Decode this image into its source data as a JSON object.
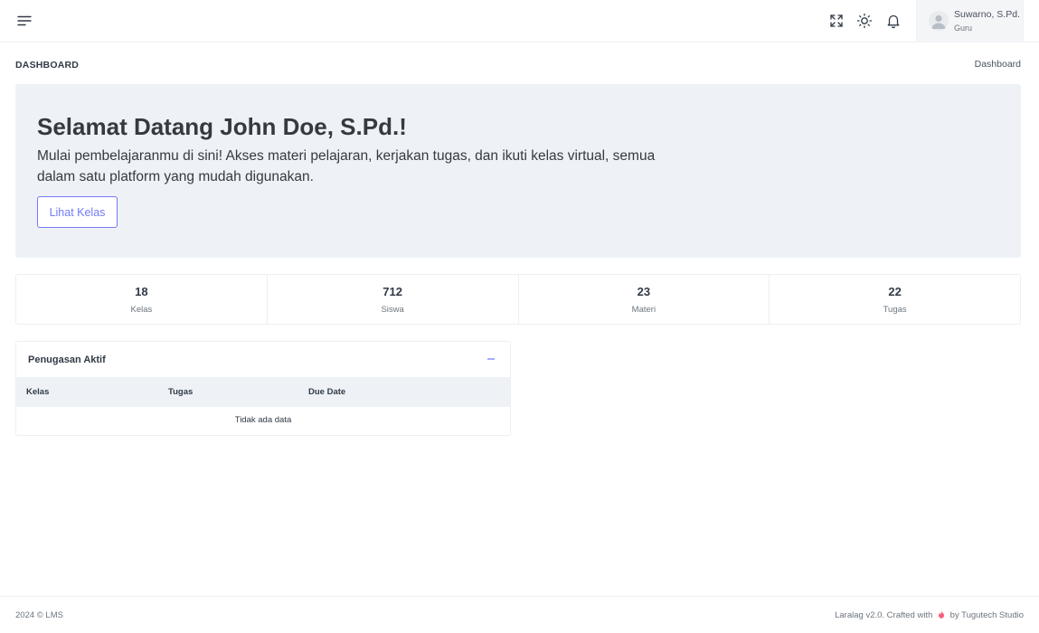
{
  "topbar": {
    "icons": [
      "menu-icon",
      "fullscreen-icon",
      "sun-icon",
      "bell-icon"
    ],
    "user": {
      "name": "Suwarno, S.Pd.",
      "role": "Guru"
    }
  },
  "page": {
    "title": "DASHBOARD",
    "breadcrumb": "Dashboard"
  },
  "hero": {
    "title": "Selamat Datang John Doe, S.Pd.!",
    "text": "Mulai pembelajaranmu di sini! Akses materi pelajaran, kerjakan tugas, dan ikuti kelas virtual, semua dalam satu platform yang mudah digunakan.",
    "button_label": "Lihat Kelas"
  },
  "stats": [
    {
      "value": "18",
      "label": "Kelas"
    },
    {
      "value": "712",
      "label": "Siswa"
    },
    {
      "value": "23",
      "label": "Materi"
    },
    {
      "value": "22",
      "label": "Tugas"
    }
  ],
  "assignments": {
    "title": "Penugasan Aktif",
    "columns": [
      "Kelas",
      "Tugas",
      "Due Date"
    ],
    "empty_text": "Tidak ada data"
  },
  "footer": {
    "left": "2024 © LMS",
    "right_prefix": "Laralag v2.0. Crafted with",
    "right_suffix": "by Tugutech Studio"
  },
  "colors": {
    "accent": "#727cf5",
    "hero_bg": "#eef2f7",
    "text": "#313a46",
    "heart": "#fa5c7c"
  }
}
